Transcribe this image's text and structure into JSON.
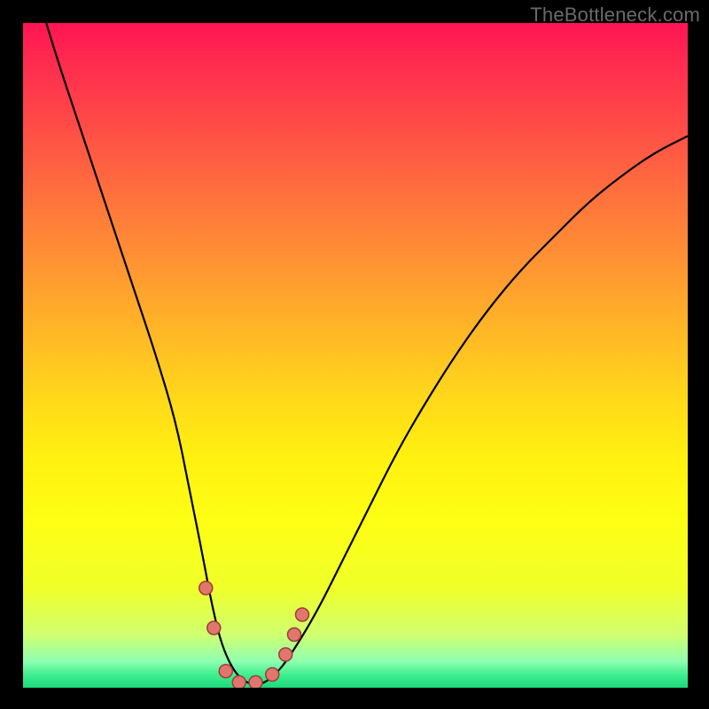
{
  "watermark": "TheBottleneck.com",
  "chart_data": {
    "type": "line",
    "title": "",
    "xlabel": "",
    "ylabel": "",
    "xlim": [
      0,
      100
    ],
    "ylim": [
      0,
      100
    ],
    "series": [
      {
        "name": "curve",
        "x": [
          2,
          5,
          8,
          11,
          14,
          17,
          20,
          23,
          25,
          27,
          28.5,
          30,
          32,
          34,
          36,
          38,
          40,
          44,
          48,
          52,
          56,
          60,
          65,
          70,
          75,
          80,
          85,
          90,
          95,
          100
        ],
        "values": [
          105,
          95,
          86,
          77,
          68,
          59,
          50,
          40,
          30,
          20,
          12,
          6,
          2,
          0.5,
          0.5,
          2,
          4.5,
          11,
          19,
          27,
          35,
          42,
          50,
          57,
          63,
          68,
          73,
          77,
          80.5,
          83
        ]
      }
    ],
    "markers": [
      {
        "x": 27.5,
        "y": 15
      },
      {
        "x": 28.7,
        "y": 9
      },
      {
        "x": 30.5,
        "y": 2.5
      },
      {
        "x": 32.5,
        "y": 0.8
      },
      {
        "x": 35.0,
        "y": 0.8
      },
      {
        "x": 37.5,
        "y": 2.0
      },
      {
        "x": 39.5,
        "y": 5.0
      },
      {
        "x": 40.8,
        "y": 8.0
      },
      {
        "x": 42.0,
        "y": 11.0
      }
    ]
  }
}
